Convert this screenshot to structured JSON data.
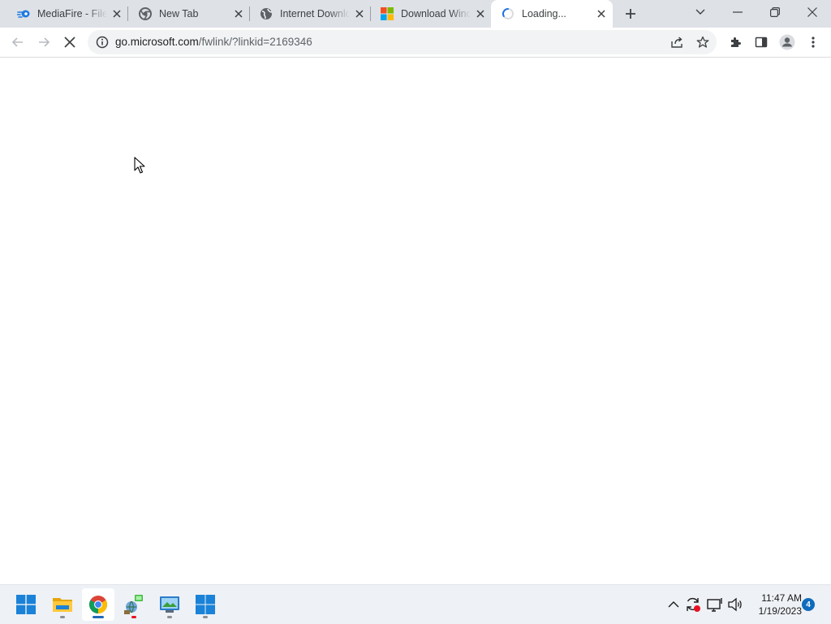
{
  "tabs": [
    {
      "title": "MediaFire - File",
      "favicon": "mediafire-icon",
      "active": false
    },
    {
      "title": "New Tab",
      "favicon": "chrome-icon",
      "active": false
    },
    {
      "title": "Internet Downlo",
      "favicon": "globe-icon",
      "active": false
    },
    {
      "title": "Download Wind",
      "favicon": "microsoft-logo-icon",
      "active": false
    },
    {
      "title": "Loading...",
      "favicon": "loading-spinner-icon",
      "active": true
    }
  ],
  "address_bar": {
    "host": "go.microsoft.com",
    "path": "/fwlink/?linkid=2169346"
  },
  "taskbar": {
    "apps": [
      "windows-start-icon",
      "file-explorer-icon",
      "chrome-icon",
      "network-app-icon",
      "control-panel-icon",
      "microsoft-store-icon"
    ],
    "clock": {
      "time": "11:47 AM",
      "date": "1/19/2023"
    },
    "notification_count": "4"
  },
  "colors": {
    "tabstrip": "#dee1e6",
    "accent": "#1a73e8",
    "taskbar": "#eef1f5"
  }
}
